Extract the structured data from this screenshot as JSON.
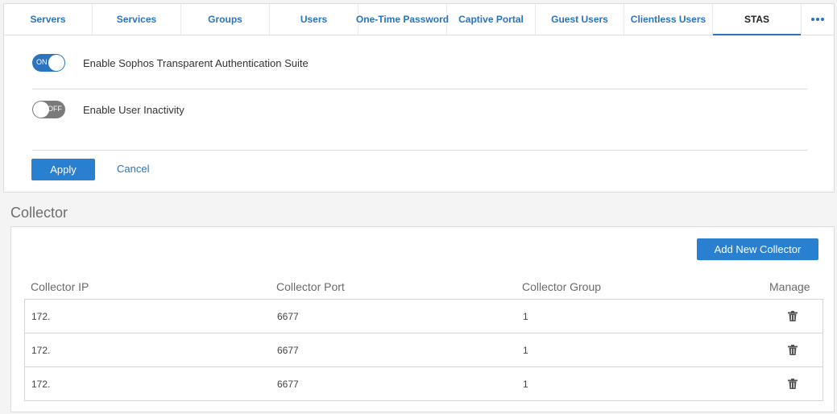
{
  "tabs": [
    {
      "label": "Servers"
    },
    {
      "label": "Services"
    },
    {
      "label": "Groups"
    },
    {
      "label": "Users"
    },
    {
      "label": "One-Time Password"
    },
    {
      "label": "Captive Portal"
    },
    {
      "label": "Guest Users"
    },
    {
      "label": "Clientless Users"
    },
    {
      "label": "STAS",
      "active": true
    }
  ],
  "settings": {
    "stas_toggle": {
      "state": "ON",
      "label": "Enable Sophos Transparent Authentication Suite"
    },
    "inactivity_toggle": {
      "state": "OFF",
      "label": "Enable User Inactivity"
    },
    "apply_label": "Apply",
    "cancel_label": "Cancel"
  },
  "collector": {
    "title": "Collector",
    "add_button_label": "Add New Collector",
    "columns": [
      "Collector IP",
      "Collector Port",
      "Collector Group",
      "Manage"
    ],
    "rows": [
      {
        "ip": "172.",
        "port": "6677",
        "group": "1"
      },
      {
        "ip": "172.",
        "port": "6677",
        "group": "1"
      },
      {
        "ip": "172.",
        "port": "6677",
        "group": "1"
      }
    ]
  },
  "colors": {
    "accent": "#2a73bf",
    "button": "#2a80d0",
    "toggle_off": "#7a7a7a"
  },
  "icons": {
    "more": "more-dots-icon",
    "delete": "trash-icon"
  }
}
